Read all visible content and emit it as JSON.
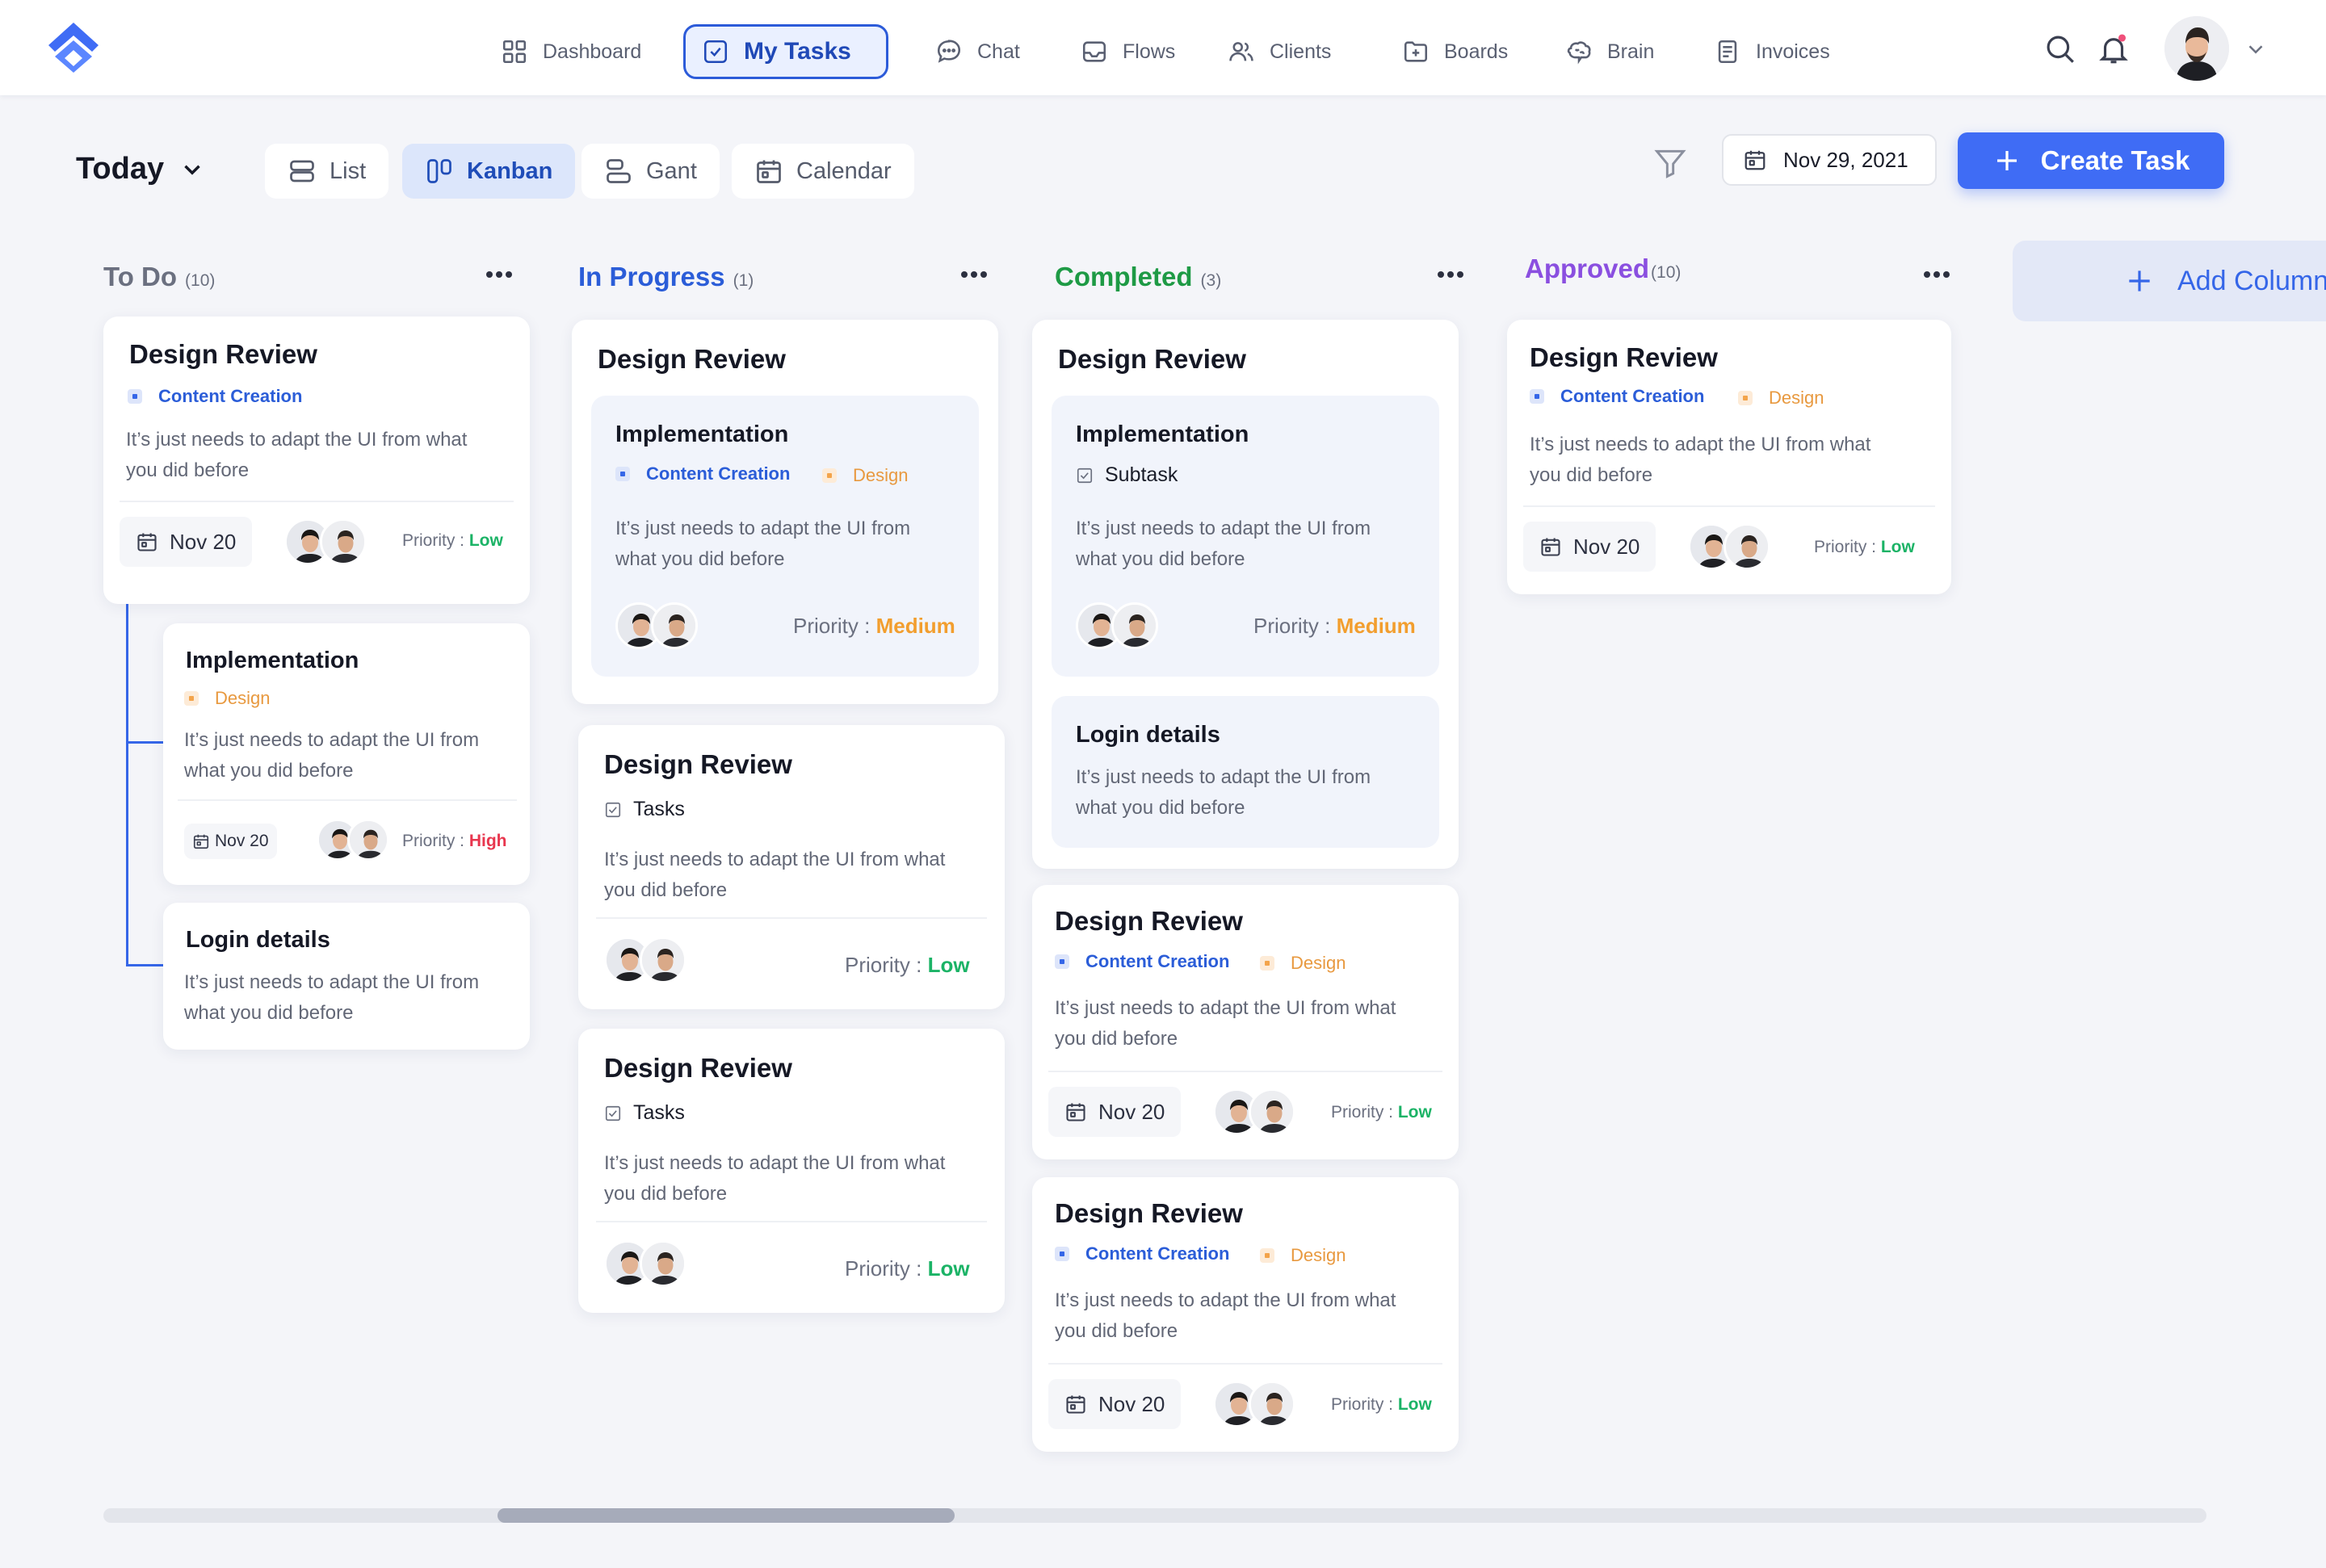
{
  "nav": {
    "items": [
      {
        "label": "Dashboard",
        "icon": "grid-icon"
      },
      {
        "label": "My Tasks",
        "icon": "check-square-icon",
        "active": true
      },
      {
        "label": "Chat",
        "icon": "chat-bubble-icon"
      },
      {
        "label": "Flows",
        "icon": "inbox-icon"
      },
      {
        "label": "Clients",
        "icon": "users-icon"
      },
      {
        "label": "Boards",
        "icon": "folder-plus-icon"
      },
      {
        "label": "Brain",
        "icon": "brain-icon"
      },
      {
        "label": "Invoices",
        "icon": "document-icon"
      }
    ],
    "right_icons": [
      "search-icon",
      "bell-icon"
    ]
  },
  "toolbar": {
    "today_label": "Today",
    "views": [
      {
        "label": "List",
        "icon": "list-icon"
      },
      {
        "label": "Kanban",
        "icon": "kanban-icon",
        "active": true
      },
      {
        "label": "Gant",
        "icon": "gantt-icon"
      },
      {
        "label": "Calendar",
        "icon": "calendar-icon"
      }
    ],
    "date": "Nov 29, 2021",
    "create_label": "Create Task"
  },
  "columns": [
    {
      "title": "To Do",
      "count": "(10)",
      "color": "#6B7080",
      "cards": [
        {
          "title": "Design Review",
          "tags": [
            "Content Creation"
          ],
          "desc": [
            "It’s just needs to adapt the UI from what",
            "you did before"
          ],
          "date": "Nov 20",
          "priority_label": "Priority : ",
          "priority": "Low"
        },
        {
          "title": "Implementation",
          "tags": [
            "Design"
          ],
          "desc": [
            "It’s just needs to adapt the UI from",
            "what you did before"
          ],
          "date": "Nov 20",
          "priority_label": "Priority : ",
          "priority": "High"
        },
        {
          "title": "Login details",
          "desc": [
            "It’s just needs to adapt the UI from",
            "what you did before"
          ]
        }
      ]
    },
    {
      "title": "In Progress",
      "count": "(1)",
      "color": "#2B5DD8",
      "cards": [
        {
          "title": "Design Review",
          "inner": {
            "title": "Implementation",
            "tags": [
              "Content Creation",
              "Design"
            ],
            "desc": [
              "It’s just needs to adapt the UI from",
              "what you did before"
            ],
            "priority_label": "Priority : ",
            "priority": "Medium"
          }
        },
        {
          "title": "Design Review",
          "subtask": "Tasks",
          "desc": [
            "It’s just needs to adapt the UI from what",
            "you did before"
          ],
          "priority_label": "Priority : ",
          "priority": "Low"
        },
        {
          "title": "Design Review",
          "subtask": "Tasks",
          "desc": [
            "It’s just needs to adapt the UI from what",
            "you did before"
          ],
          "priority_label": "Priority : ",
          "priority": "Low"
        }
      ]
    },
    {
      "title": "Completed",
      "count": "(3)",
      "color": "#1E9A45",
      "cards": [
        {
          "title": "Design Review",
          "inner": {
            "title": "Implementation",
            "subtask": "Subtask",
            "desc": [
              "It’s just needs to adapt the UI from",
              "what you did before"
            ],
            "priority_label": "Priority : ",
            "priority": "Medium"
          },
          "inner2": {
            "title": "Login details",
            "desc": [
              "It’s just needs to adapt the UI from",
              "what you did before"
            ]
          }
        },
        {
          "title": "Design Review",
          "tags": [
            "Content Creation",
            "Design"
          ],
          "desc": [
            "It’s just needs to adapt the UI from what",
            "you did before"
          ],
          "date": "Nov 20",
          "priority_label": "Priority : ",
          "priority": "Low"
        },
        {
          "title": "Design Review",
          "tags": [
            "Content Creation",
            "Design"
          ],
          "desc": [
            "It’s just needs to adapt the UI from what",
            "you did before"
          ],
          "date": "Nov 20",
          "priority_label": "Priority : ",
          "priority": "Low"
        }
      ]
    },
    {
      "title": "Approved",
      "count": "(10)",
      "color": "#8A4FE0",
      "cards": [
        {
          "title": "Design Review",
          "tags": [
            "Content Creation",
            "Design"
          ],
          "desc": [
            "It’s just needs to adapt the UI from what",
            "you did before"
          ],
          "date": "Nov 20",
          "priority_label": "Priority : ",
          "priority": "Low"
        }
      ]
    }
  ],
  "add_column_label": "Add Column",
  "colors": {
    "accent": "#3F6CF5",
    "low": "#1BB366",
    "medium": "#F29E2E",
    "high": "#E8364E"
  }
}
